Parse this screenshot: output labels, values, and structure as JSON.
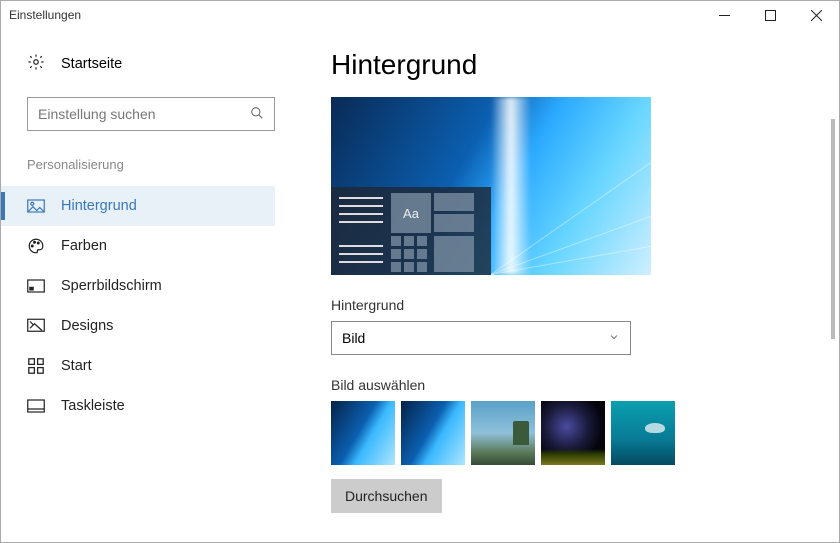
{
  "window": {
    "title": "Einstellungen"
  },
  "sidebar": {
    "home_label": "Startseite",
    "search_placeholder": "Einstellung suchen",
    "category_header": "Personalisierung",
    "items": [
      {
        "label": "Hintergrund"
      },
      {
        "label": "Farben"
      },
      {
        "label": "Sperrbildschirm"
      },
      {
        "label": "Designs"
      },
      {
        "label": "Start"
      },
      {
        "label": "Taskleiste"
      }
    ]
  },
  "main": {
    "page_title": "Hintergrund",
    "preview_text": "Aa",
    "bg_label": "Hintergrund",
    "bg_dropdown_value": "Bild",
    "choose_image_label": "Bild auswählen",
    "browse_label": "Durchsuchen"
  }
}
